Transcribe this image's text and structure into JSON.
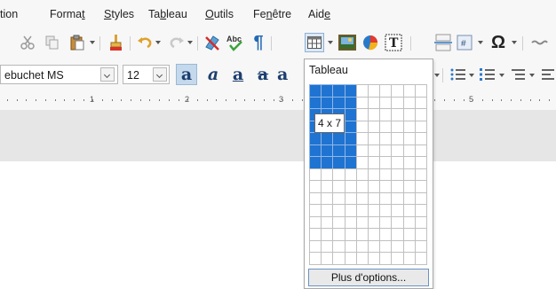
{
  "menubar": {
    "items": [
      {
        "label": "tion",
        "name": "menu-insertion-partial"
      },
      {
        "label": "Format",
        "name": "menu-format"
      },
      {
        "label": "Styles",
        "name": "menu-styles"
      },
      {
        "label": "Tableau",
        "name": "menu-tableau"
      },
      {
        "label": "Outils",
        "name": "menu-outils"
      },
      {
        "label": "Fenêtre",
        "name": "menu-fenetre"
      },
      {
        "label": "Aide",
        "name": "menu-aide"
      }
    ]
  },
  "toolbar1": {
    "icons": [
      "cut-icon",
      "copy-icon",
      "paste-icon",
      "clone-formatting-icon",
      "undo-icon",
      "redo-icon",
      "clear-formatting-icon",
      "spelling-icon",
      "formatting-marks-icon",
      "insert-table-icon",
      "insert-image-icon",
      "insert-chart-icon",
      "text-box-icon",
      "page-break-icon",
      "field-icon",
      "special-character-icon",
      "hyperlink-icon"
    ],
    "omega": "Ω",
    "pilcrow": "¶",
    "abc": "Abc",
    "textbox_letter": "T",
    "field_symbol": "#"
  },
  "toolbar2": {
    "font_name": "ebuchet MS",
    "font_size": "12",
    "format_glyphs": [
      "a",
      "a",
      "a",
      "a",
      "a"
    ]
  },
  "ruler": {
    "numbers": [
      "1",
      "2",
      "3",
      "5"
    ]
  },
  "table_popup": {
    "title": "Tableau",
    "grid_columns": 10,
    "grid_rows": 15,
    "selected_columns": 4,
    "selected_rows": 7,
    "size_label": "4 x 7",
    "more_options_label": "Plus d'options..."
  },
  "colors": {
    "selection_blue": "#1f73d1",
    "toolbar_bg": "#f7f7f7",
    "document_gray": "#e6e6e6"
  }
}
